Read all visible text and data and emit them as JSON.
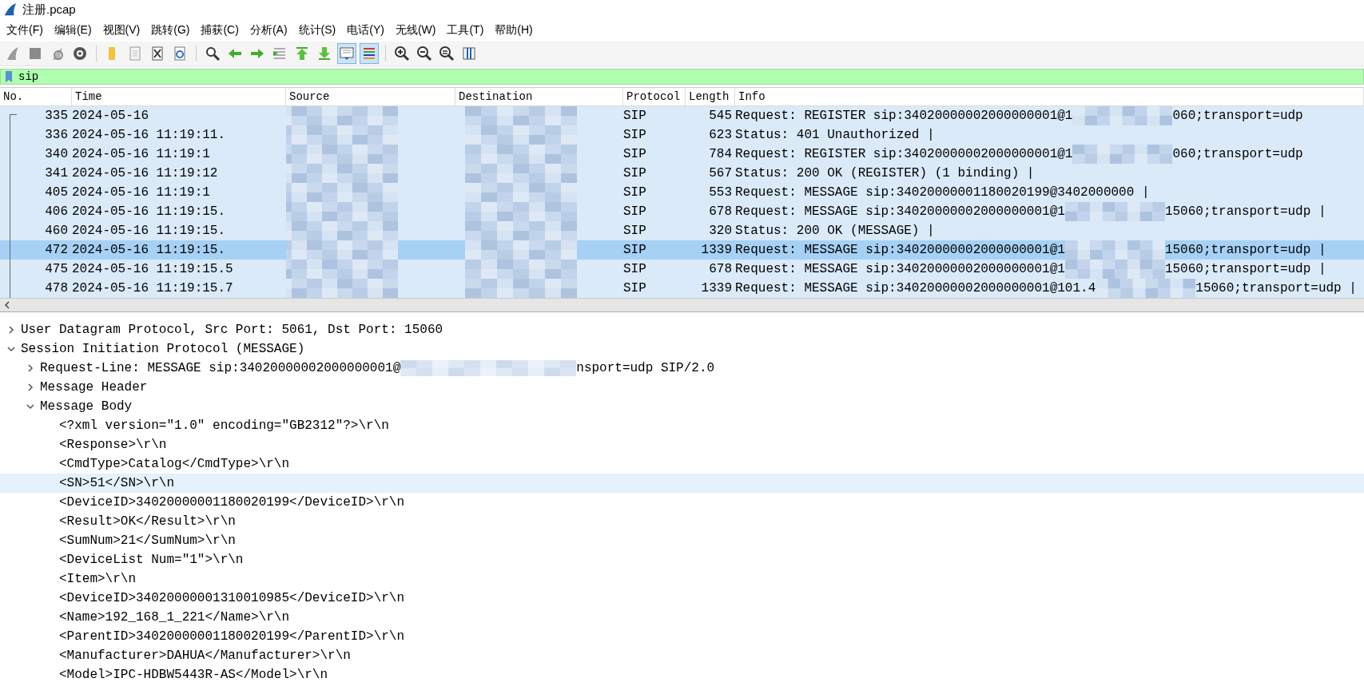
{
  "window": {
    "title": "注册.pcap"
  },
  "menu": [
    "文件(F)",
    "编辑(E)",
    "视图(V)",
    "跳转(G)",
    "捕获(C)",
    "分析(A)",
    "统计(S)",
    "电话(Y)",
    "无线(W)",
    "工具(T)",
    "帮助(H)"
  ],
  "toolbar": [
    {
      "kind": "fin",
      "pressed": false
    },
    {
      "kind": "stop",
      "pressed": false
    },
    {
      "kind": "restart",
      "pressed": false
    },
    {
      "kind": "options",
      "pressed": false
    },
    {
      "kind": "separator"
    },
    {
      "kind": "open",
      "pressed": false
    },
    {
      "kind": "file",
      "pressed": false
    },
    {
      "kind": "close",
      "pressed": false
    },
    {
      "kind": "reload",
      "pressed": false
    },
    {
      "kind": "separator"
    },
    {
      "kind": "find",
      "pressed": false
    },
    {
      "kind": "back",
      "pressed": false
    },
    {
      "kind": "forward",
      "pressed": false
    },
    {
      "kind": "goto",
      "pressed": false
    },
    {
      "kind": "first",
      "pressed": false
    },
    {
      "kind": "last",
      "pressed": false
    },
    {
      "kind": "autoscroll",
      "pressed": true
    },
    {
      "kind": "colorize",
      "pressed": true
    },
    {
      "kind": "separator"
    },
    {
      "kind": "zoom-in",
      "pressed": false
    },
    {
      "kind": "zoom-out",
      "pressed": false
    },
    {
      "kind": "zoom-reset",
      "pressed": false
    },
    {
      "kind": "resize",
      "pressed": false
    }
  ],
  "filter": {
    "value": "sip"
  },
  "packet_list": {
    "columns": [
      "No.",
      "Time",
      "Source",
      "Destination",
      "Protocol",
      "Length",
      "Info"
    ],
    "rows": [
      {
        "no": "335",
        "time": "2024-05-16",
        "protocol": "SIP",
        "length": "545",
        "info": [
          "Request: REGISTER sip:34020000002000000001@1",
          "060;transport=udp"
        ],
        "selected": false
      },
      {
        "no": "336",
        "time": "2024-05-16 11:19:11.",
        "protocol": "SIP",
        "length": "623",
        "info": [
          "Status: 401 Unauthorized |"
        ],
        "selected": false
      },
      {
        "no": "340",
        "time": "2024-05-16 11:19:1",
        "protocol": "SIP",
        "length": "784",
        "info": [
          "Request: REGISTER sip:34020000002000000001@1",
          "060;transport=udp"
        ],
        "selected": false
      },
      {
        "no": "341",
        "time": "2024-05-16 11:19:12",
        "protocol": "SIP",
        "length": "567",
        "info": [
          "Status: 200 OK (REGISTER)  (1 binding) |"
        ],
        "selected": false
      },
      {
        "no": "405",
        "time": "2024-05-16 11:19:1",
        "protocol": "SIP",
        "length": "553",
        "info": [
          "Request: MESSAGE sip:34020000001180020199@3402000000 |"
        ],
        "selected": false
      },
      {
        "no": "406",
        "time": "2024-05-16 11:19:15.",
        "protocol": "SIP",
        "length": "678",
        "info": [
          "Request: MESSAGE sip:34020000002000000001@1",
          "15060;transport=udp |"
        ],
        "selected": false
      },
      {
        "no": "460",
        "time": "2024-05-16 11:19:15.",
        "protocol": "SIP",
        "length": "320",
        "info": [
          "Status: 200 OK (MESSAGE) |"
        ],
        "selected": false
      },
      {
        "no": "472",
        "time": "2024-05-16 11:19:15.",
        "protocol": "SIP",
        "length": "1339",
        "info": [
          "Request: MESSAGE sip:34020000002000000001@1",
          "15060;transport=udp |"
        ],
        "selected": true
      },
      {
        "no": "475",
        "time": "2024-05-16 11:19:15.5",
        "protocol": "SIP",
        "length": "678",
        "info": [
          "Request: MESSAGE sip:34020000002000000001@1",
          "15060;transport=udp |"
        ],
        "selected": false
      },
      {
        "no": "478",
        "time": "2024-05-16 11:19:15.7",
        "protocol": "SIP",
        "length": "1339",
        "info": [
          "Request: MESSAGE sip:34020000002000000001@101.4",
          "15060;transport=udp |"
        ],
        "selected": false
      }
    ]
  },
  "details": [
    {
      "text": [
        "User Datagram Protocol, Src Port: 5061, Dst Port: 15060"
      ],
      "expanded": false,
      "selected": false
    },
    {
      "text": [
        "Session Initiation Protocol (MESSAGE)"
      ],
      "expanded": true,
      "selected": false,
      "children": [
        {
          "text": [
            "Request-Line: MESSAGE sip:34020000002000000001@",
            "nsport=udp SIP/2.0"
          ],
          "expanded": false,
          "selected": false
        },
        {
          "text": [
            "Message Header"
          ],
          "expanded": false,
          "selected": false
        },
        {
          "text": [
            "Message Body"
          ],
          "expanded": true,
          "selected": false,
          "children": [
            {
              "text": [
                "<?xml version=\"1.0\" encoding=\"GB2312\"?>\\r\\n"
              ],
              "selected": false
            },
            {
              "text": [
                "<Response>\\r\\n"
              ],
              "selected": false
            },
            {
              "text": [
                "<CmdType>Catalog</CmdType>\\r\\n"
              ],
              "selected": false
            },
            {
              "text": [
                "<SN>51</SN>\\r\\n"
              ],
              "selected": true
            },
            {
              "text": [
                "<DeviceID>34020000001180020199</DeviceID>\\r\\n"
              ],
              "selected": false
            },
            {
              "text": [
                "<Result>OK</Result>\\r\\n"
              ],
              "selected": false
            },
            {
              "text": [
                "<SumNum>21</SumNum>\\r\\n"
              ],
              "selected": false
            },
            {
              "text": [
                "<DeviceList Num=\"1\">\\r\\n"
              ],
              "selected": false
            },
            {
              "text": [
                "<Item>\\r\\n"
              ],
              "selected": false
            },
            {
              "text": [
                "<DeviceID>34020000001310010985</DeviceID>\\r\\n"
              ],
              "selected": false
            },
            {
              "text": [
                "<Name>192_168_1_221</Name>\\r\\n"
              ],
              "selected": false
            },
            {
              "text": [
                "<ParentID>34020000001180020199</ParentID>\\r\\n"
              ],
              "selected": false
            },
            {
              "text": [
                "<Manufacturer>DAHUA</Manufacturer>\\r\\n"
              ],
              "selected": false
            },
            {
              "text": [
                "<Model>IPC-HDBW5443R-AS</Model>\\r\\n"
              ],
              "selected": false
            }
          ]
        }
      ]
    }
  ]
}
